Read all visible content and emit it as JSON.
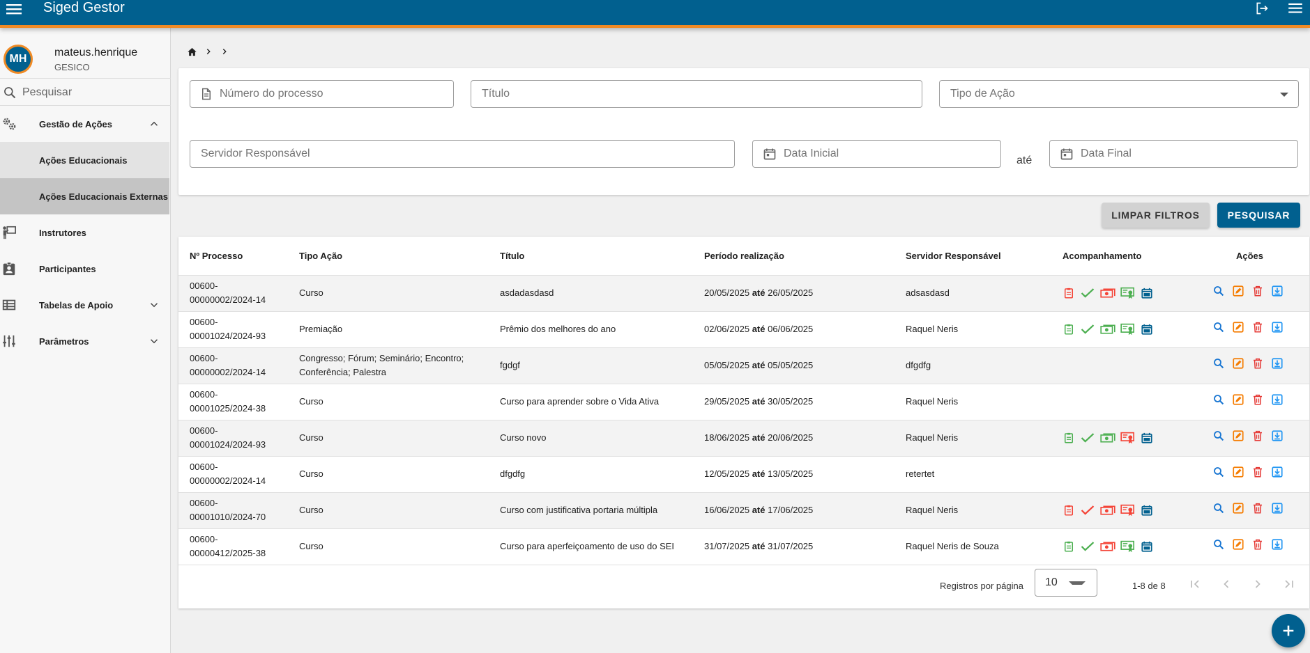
{
  "app": {
    "title": "Siged Gestor"
  },
  "user": {
    "initials": "MH",
    "name": "mateus.henrique",
    "org": "GESICO"
  },
  "sidebar": {
    "search_placeholder": "Pesquisar",
    "items": [
      {
        "label": "Gestão de Ações",
        "icon": "gears-icon",
        "expanded": true,
        "children": [
          {
            "label": "Ações Educacionais"
          },
          {
            "label": "Ações Educacionais Externas",
            "active": true
          }
        ]
      },
      {
        "label": "Instrutores",
        "icon": "instructor-icon"
      },
      {
        "label": "Participantes",
        "icon": "badge-icon"
      },
      {
        "label": "Tabelas de Apoio",
        "icon": "table-icon",
        "expandable": true
      },
      {
        "label": "Parâmetros",
        "icon": "tune-icon",
        "expandable": true
      }
    ]
  },
  "filters": {
    "processo_placeholder": "Número do processo",
    "titulo_placeholder": "Título",
    "tipo_acao_placeholder": "Tipo de Ação",
    "servidor_placeholder": "Servidor Responsável",
    "data_inicial_placeholder": "Data Inicial",
    "ate_label": "até",
    "data_final_placeholder": "Data Final"
  },
  "buttons": {
    "clear": "LIMPAR FILTROS",
    "search": "PESQUISAR"
  },
  "table": {
    "headers": [
      "Nº Processo",
      "Tipo Ação",
      "Título",
      "Período realização",
      "Servidor Responsável",
      "Acompanhamento",
      "Ações"
    ],
    "period_sep": "até",
    "rows": [
      {
        "processo": "00600-00000002/2024-14",
        "tipo": "Curso",
        "titulo": "asdadasdasd",
        "inicio": "20/05/2025",
        "fim": "26/05/2025",
        "servidor": "adsasdasd",
        "acomp": [
          "red",
          "green",
          "red",
          "green",
          "blue"
        ]
      },
      {
        "processo": "00600-00001024/2024-93",
        "tipo": "Premiação",
        "titulo": "Prêmio dos melhores do ano",
        "inicio": "02/06/2025",
        "fim": "06/06/2025",
        "servidor": "Raquel Neris",
        "acomp": [
          "green",
          "green",
          "green",
          "green",
          "blue"
        ]
      },
      {
        "processo": "00600-00000002/2024-14",
        "tipo": "Congresso; Fórum; Seminário; Encontro; Conferência; Palestra",
        "titulo": "fgdgf",
        "inicio": "05/05/2025",
        "fim": "05/05/2025",
        "servidor": "dfgdfg",
        "acomp": []
      },
      {
        "processo": "00600-00001025/2024-38",
        "tipo": "Curso",
        "titulo": "Curso para aprender sobre o Vida Ativa",
        "inicio": "29/05/2025",
        "fim": "30/05/2025",
        "servidor": "Raquel Neris",
        "acomp": []
      },
      {
        "processo": "00600-00001024/2024-93",
        "tipo": "Curso",
        "titulo": "Curso novo",
        "inicio": "18/06/2025",
        "fim": "20/06/2025",
        "servidor": "Raquel Neris",
        "acomp": [
          "green",
          "green",
          "green",
          "red",
          "blue"
        ]
      },
      {
        "processo": "00600-00000002/2024-14",
        "tipo": "Curso",
        "titulo": "dfgdfg",
        "inicio": "12/05/2025",
        "fim": "13/05/2025",
        "servidor": "retertet",
        "acomp": []
      },
      {
        "processo": "00600-00001010/2024-70",
        "tipo": "Curso",
        "titulo": "Curso com justificativa portaria múltipla",
        "inicio": "16/06/2025",
        "fim": "17/06/2025",
        "servidor": "Raquel Neris",
        "acomp": [
          "red",
          "red",
          "red",
          "red",
          "blue"
        ]
      },
      {
        "processo": "00600-00000412/2025-38",
        "tipo": "Curso",
        "titulo": "Curso para aperfeiçoamento de uso do SEI",
        "inicio": "31/07/2025",
        "fim": "31/07/2025",
        "servidor": "Raquel Neris de Souza",
        "acomp": [
          "green",
          "green",
          "red",
          "green",
          "blue"
        ]
      }
    ],
    "acomp_icons": [
      "clipboard-icon",
      "check-icon",
      "money-icon",
      "certificate-icon",
      "calendar-icon"
    ],
    "action_icons": [
      "search-icon",
      "edit-icon",
      "delete-icon",
      "download-icon"
    ]
  },
  "paginator": {
    "label": "Registros por página",
    "page_size": "10",
    "range": "1-8 de 8"
  },
  "colors": {
    "primary": "#01608f",
    "accent": "#f08a24",
    "green": "#4caf50",
    "red": "#f44336",
    "blue": "#01608f",
    "action_blue": "#1976d2",
    "action_orange": "#f57c00",
    "action_red": "#e53935",
    "action_lightblue": "#2196f3"
  }
}
